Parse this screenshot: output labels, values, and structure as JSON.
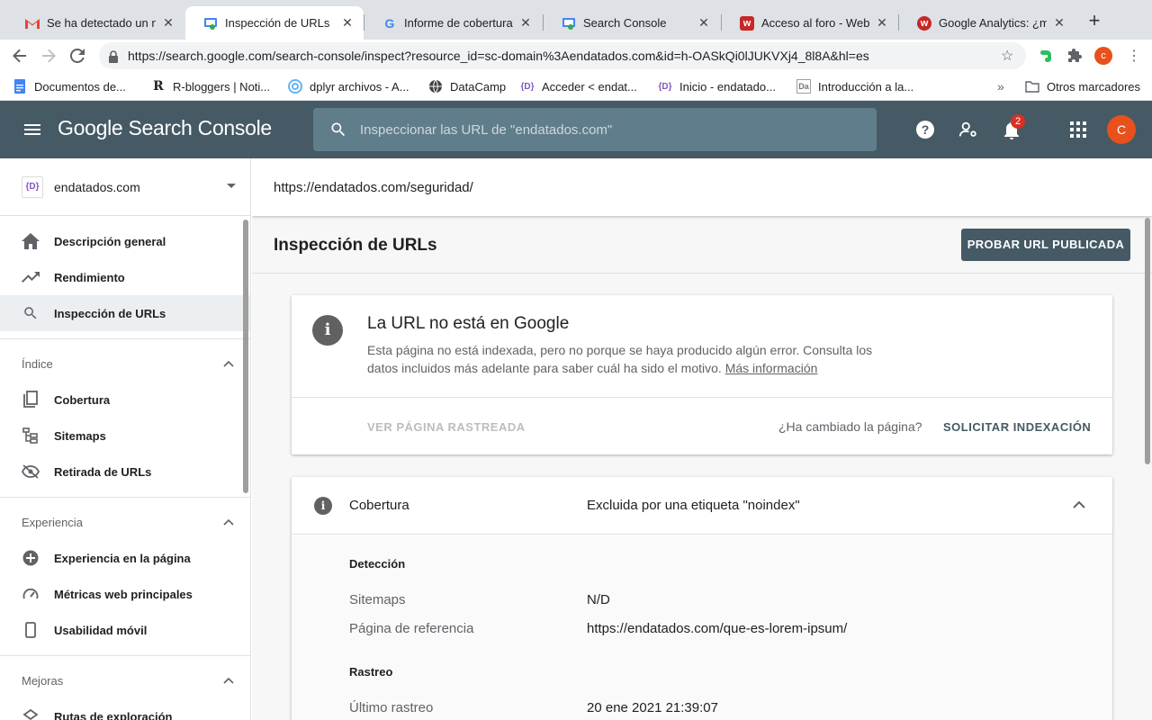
{
  "browser": {
    "tabs": [
      {
        "title": "Se ha detectado un nue",
        "favicon": "gmail-icon"
      },
      {
        "title": "Inspección de URLs",
        "favicon": "search-console-icon"
      },
      {
        "title": "Informe de cobertura d",
        "favicon": "google-icon"
      },
      {
        "title": "Search Console",
        "favicon": "search-console-icon"
      },
      {
        "title": "Acceso al foro - Weber",
        "favicon": "webempresa-icon"
      },
      {
        "title": "Google Analytics: ¿mej",
        "favicon": "webempresa-icon"
      }
    ],
    "address": "https://search.google.com/search-console/inspect?resource_id=sc-domain%3Aendatados.com&id=h-OASkQi0lJUKVXj4_8l8A&hl=es",
    "profile_initial": "c",
    "bookmarks": [
      "Documentos de...",
      "R-bloggers | Noti...",
      "dplyr archivos - A...",
      "DataCamp",
      "Acceder < endat...",
      "Inicio - endatado...",
      "Introducción a la..."
    ],
    "other_bookmarks": "Otros marcadores"
  },
  "header": {
    "logo_google": "Google",
    "logo_product": " Search Console",
    "search_placeholder": "Inspeccionar las URL de \"endatados.com\"",
    "notifications_count": "2",
    "avatar_initial": "C"
  },
  "sidebar": {
    "property": "endatados.com",
    "property_icon_text": "{D}",
    "top_items": [
      {
        "label": "Descripción general",
        "icon": "home-icon"
      },
      {
        "label": "Rendimiento",
        "icon": "trending-up-icon"
      },
      {
        "label": "Inspección de URLs",
        "icon": "search-icon"
      }
    ],
    "sections": [
      {
        "title": "Índice",
        "items": [
          {
            "label": "Cobertura",
            "icon": "copy-icon"
          },
          {
            "label": "Sitemaps",
            "icon": "sitemap-icon"
          },
          {
            "label": "Retirada de URLs",
            "icon": "visibility-off-icon"
          }
        ]
      },
      {
        "title": "Experiencia",
        "items": [
          {
            "label": "Experiencia en la página",
            "icon": "add-circle-icon"
          },
          {
            "label": "Métricas web principales",
            "icon": "speed-icon"
          },
          {
            "label": "Usabilidad móvil",
            "icon": "phone-icon"
          }
        ]
      },
      {
        "title": "Mejoras",
        "items": [
          {
            "label": "Rutas de exploración",
            "icon": "layers-icon"
          }
        ]
      }
    ]
  },
  "main": {
    "inspected_url": "https://endatados.com/seguridad/",
    "page_title": "Inspección de URLs",
    "test_button": "PROBAR URL PUBLICADA",
    "status": {
      "title": "La URL no está en Google",
      "description": "Esta página no está indexada, pero no porque se haya producido algún error. Consulta los datos incluidos más adelante para saber cuál ha sido el motivo.",
      "link": "Más información",
      "view_crawled": "VER PÁGINA RASTREADA",
      "changed_question": "¿Ha cambiado la página?",
      "request_indexing": "SOLICITAR INDEXACIÓN"
    },
    "coverage": {
      "label": "Cobertura",
      "value": "Excluida por una etiqueta \"noindex\"",
      "detection_heading": "Detección",
      "sitemaps_label": "Sitemaps",
      "sitemaps_value": "N/D",
      "referrer_label": "Página de referencia",
      "referrer_value": "https://endatados.com/que-es-lorem-ipsum/",
      "crawl_heading": "Rastreo",
      "last_crawl_label": "Último rastreo",
      "last_crawl_value": "20 ene 2021 21:39:07"
    }
  },
  "colors": {
    "header_bg": "#455a64",
    "search_bg": "#607d8b",
    "accent_button": "#455a64",
    "avatar": "#e8501c",
    "badge": "#d93025"
  }
}
